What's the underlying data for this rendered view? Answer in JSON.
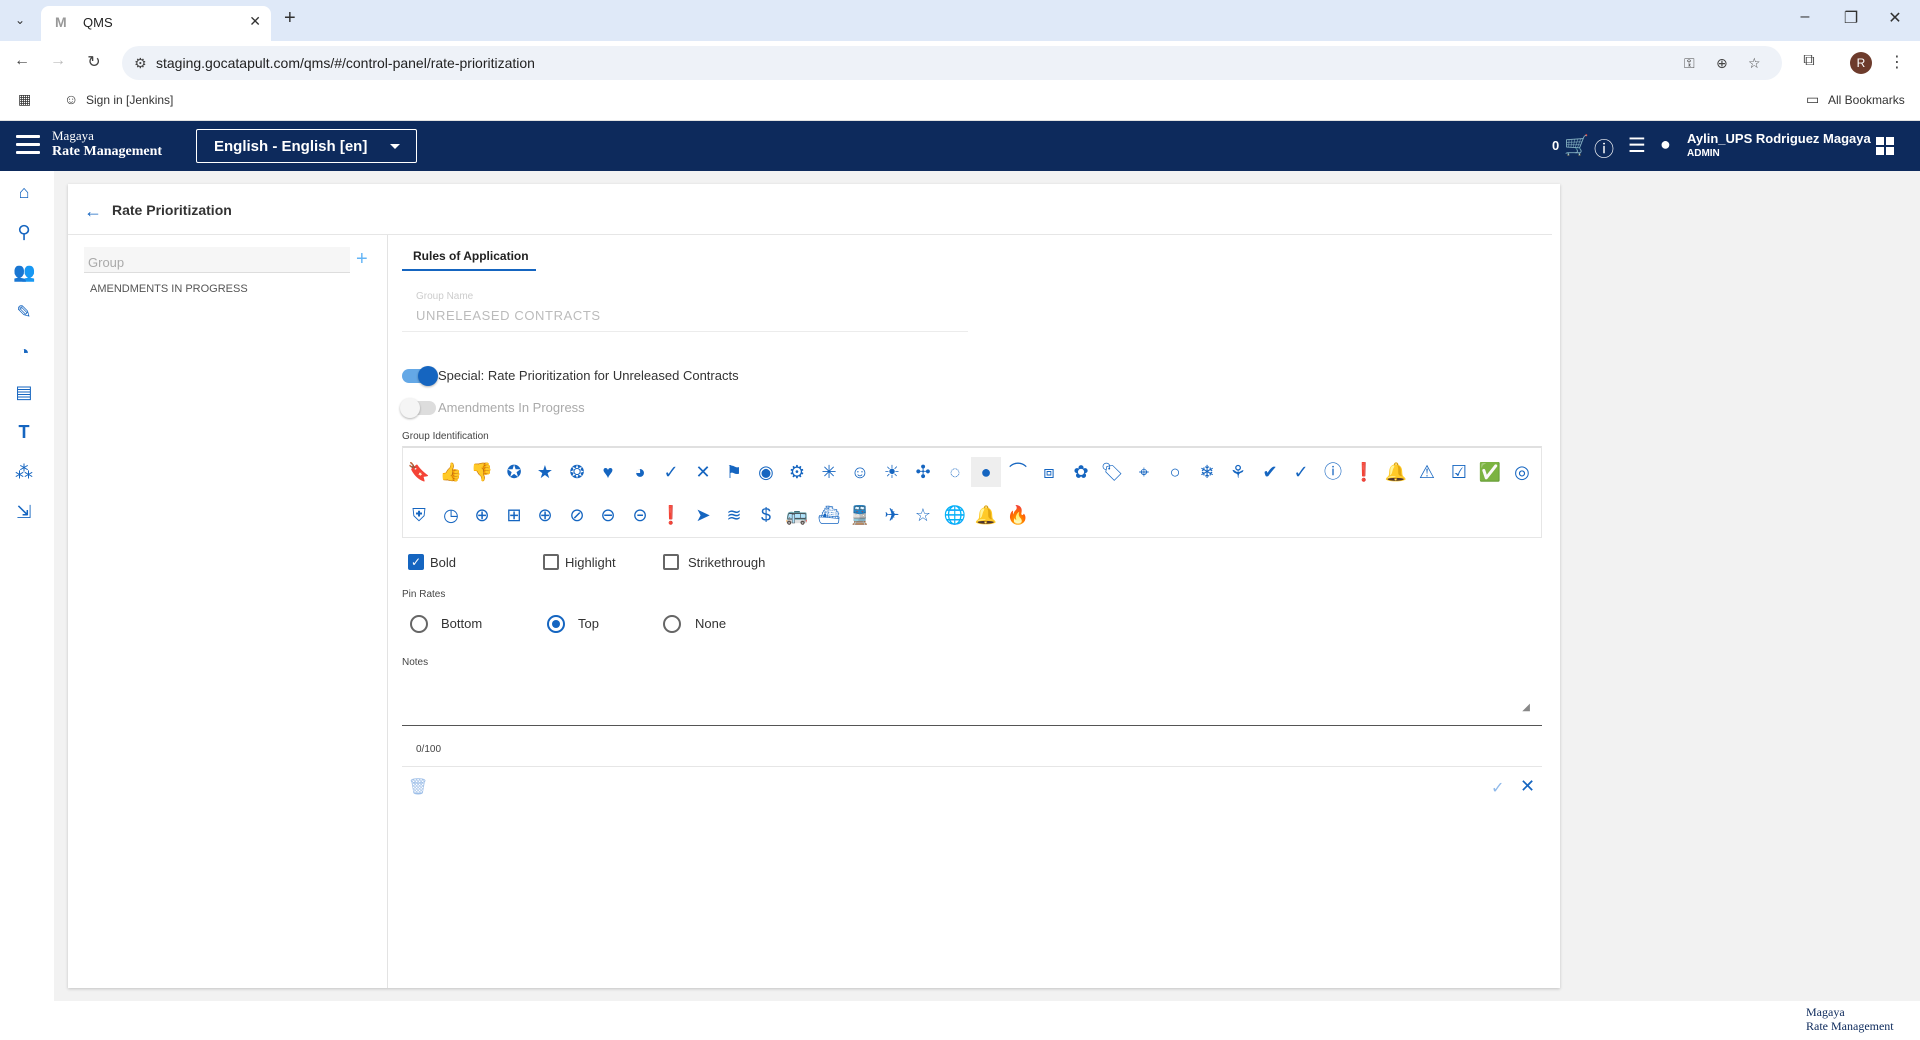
{
  "browser": {
    "tab_title": "QMS",
    "favicon": "M",
    "url": "staging.gocatapult.com/qms/#/control-panel/rate-prioritization",
    "profile_initial": "R",
    "bookmark_item": "Sign in [Jenkins]",
    "all_bookmarks": "All Bookmarks"
  },
  "header": {
    "brand_line1": "Magaya",
    "brand_line2": "Rate Management",
    "language": "English - English [en]",
    "cart_count": "0",
    "user_name": "Aylin_UPS Rodriguez Magaya",
    "user_role": "ADMIN"
  },
  "page": {
    "title": "Rate Prioritization",
    "group_placeholder": "Group",
    "groups": [
      "AMENDMENTS IN PROGRESS"
    ]
  },
  "form": {
    "tab_label": "Rules of Application",
    "group_name_label": "Group Name",
    "group_name_value": "UNRELEASED CONTRACTS",
    "toggle_special_label": "Special: Rate Prioritization for Unreleased Contracts",
    "toggle_special_on": true,
    "toggle_amend_label": "Amendments In Progress",
    "toggle_amend_on": false,
    "group_identification_label": "Group Identification",
    "selected_icon": "circle-filled-icon",
    "bold_label": "Bold",
    "bold_checked": true,
    "highlight_label": "Highlight",
    "highlight_checked": false,
    "strikethrough_label": "Strikethrough",
    "strikethrough_checked": false,
    "pin_rates_label": "Pin Rates",
    "pin_bottom_label": "Bottom",
    "pin_top_label": "Top",
    "pin_none_label": "None",
    "pin_selected": "Top",
    "notes_label": "Notes",
    "notes_value": "",
    "notes_counter": "0/100"
  },
  "footer": {
    "brand_line1": "Magaya",
    "brand_line2": "Rate Management"
  },
  "colors": {
    "header_bg": "#0d2a5c",
    "accent": "#1565c0",
    "tabbar_bg": "#dfe9f8"
  }
}
